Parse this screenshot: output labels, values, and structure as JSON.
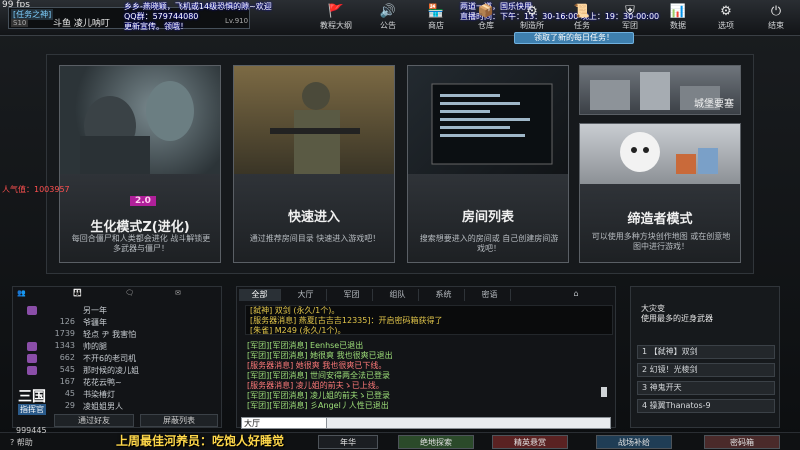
{
  "fps": "99 fps",
  "overlay_left": [
    "乡乡-燕晓颖，飞机或14级恐惧的隙~欢迎",
    "QQ群：579744080",
    "更新宣传。领哦！"
  ],
  "overlay_right": [
    "两道一道，国乐快用",
    "直播时间：下午：13：30-16:00   晚上：19：30-00:00"
  ],
  "profile": {
    "tag": "[任务之神]",
    "id_tag": "S10",
    "name": "斗鱼 凌儿呐叮",
    "level": "Lv.910"
  },
  "top_menu": [
    {
      "label": "教程大纲",
      "icon": "🚩"
    },
    {
      "label": "公告",
      "icon": "🔊"
    },
    {
      "label": "商店",
      "icon": "🏪"
    },
    {
      "label": "仓库",
      "icon": "📦"
    },
    {
      "label": "制造所",
      "icon": "⚙"
    },
    {
      "label": "任务",
      "icon": "📜"
    },
    {
      "label": "军团",
      "icon": "⛨"
    },
    {
      "label": "数据",
      "icon": "📊"
    },
    {
      "label": "选项",
      "icon": "⚙"
    },
    {
      "label": "结束",
      "icon": "⏻"
    }
  ],
  "notice": "领取了新的每日任务！",
  "modes": [
    {
      "title": "生化模式Z(进化)",
      "desc": "每回合僵尸和人类都会进化 战斗解锁更多武器与僵尸！",
      "badge": "2.0"
    },
    {
      "title": "快速进入",
      "desc": "通过推荐房间目录 快速进入游戏吧！"
    },
    {
      "title": "房间列表",
      "desc": "搜索想要进入的房间或 自己创建房间游戏吧！"
    },
    {
      "title": "缔造者模式",
      "desc": "可以使用多种方块创作地图 或在创意地图中进行游戏！"
    }
  ],
  "castle_mode": "城堡要塞",
  "popularity": "人气值：1003957",
  "friends": {
    "tabs": [
      "",
      "",
      "",
      ""
    ],
    "rows": [
      {
        "num": "",
        "name": "另一年"
      },
      {
        "num": "126",
        "name": "爷疆年"
      },
      {
        "num": "1739",
        "name": "轻点 ヂ 我害怕"
      },
      {
        "num": "1343",
        "name": "帅的腿"
      },
      {
        "num": "662",
        "name": "不开6的老司机"
      },
      {
        "num": "545",
        "name": "那时候的凌儿姐"
      },
      {
        "num": "167",
        "name": "花花云鸭~"
      },
      {
        "num": "45",
        "name": "书染椿灯"
      },
      {
        "num": "29",
        "name": "凌姐姐男人"
      }
    ],
    "add_label": "通过好友",
    "block_label": "屏蔽列表",
    "tag": "三国",
    "name_tag": "指挥官"
  },
  "chat": {
    "tabs": [
      "全部",
      "大厅",
      "军团",
      "组队",
      "系统",
      "密语",
      "⌂"
    ],
    "sys_lines": [
      {
        "text": "[弑神] 双剑 (永久/1个)。",
        "color": "#e2c64a"
      },
      {
        "text": "[服务器消息] 燕夏[古吉吉12335]：开启密码箱获得了",
        "color": "#e2c64a"
      },
      {
        "text": "[朱雀] M249 (永久/1个)。",
        "color": "#e2c64a"
      }
    ],
    "lines": [
      {
        "text": "[军团][军团消息] Eenhse已退出",
        "color": "#9fe07a"
      },
      {
        "text": "[军团][军团消息] 她很爽 我也很爽已退出",
        "color": "#9fe07a"
      },
      {
        "text": "[服务器消息] 她很爽 我也很爽已下线。",
        "color": "#ff7a7a"
      },
      {
        "text": "[军团][军团消息] 世间安得两全法已登录",
        "color": "#9fe07a"
      },
      {
        "text": "[服务器消息] 凌儿姐的前夫ゝ已上线。",
        "color": "#ff7a7a"
      },
      {
        "text": "[军团][军团消息] 凌儿姐的前夫ゝ已登录",
        "color": "#9fe07a"
      },
      {
        "text": "[军团][军团消息] 彡Angel丿人性已退出",
        "color": "#9fe07a"
      }
    ],
    "channel": "大厅"
  },
  "weapon_panel": {
    "title": "大灾变",
    "subtitle": "使用最多的近身武器",
    "items": [
      "1 【弑神】双剑",
      "2 幻镜！光棱剑",
      "3 神鬼开天",
      "4 操翼Thanatos-9"
    ]
  },
  "bottom": {
    "coin": "999445",
    "help": "帮助",
    "weekly": "上周最佳河养员：吃饱人好睡觉",
    "buttons": [
      "年华",
      "绝地探索",
      "精英悬赏",
      "战场补给",
      "密码箱"
    ]
  }
}
